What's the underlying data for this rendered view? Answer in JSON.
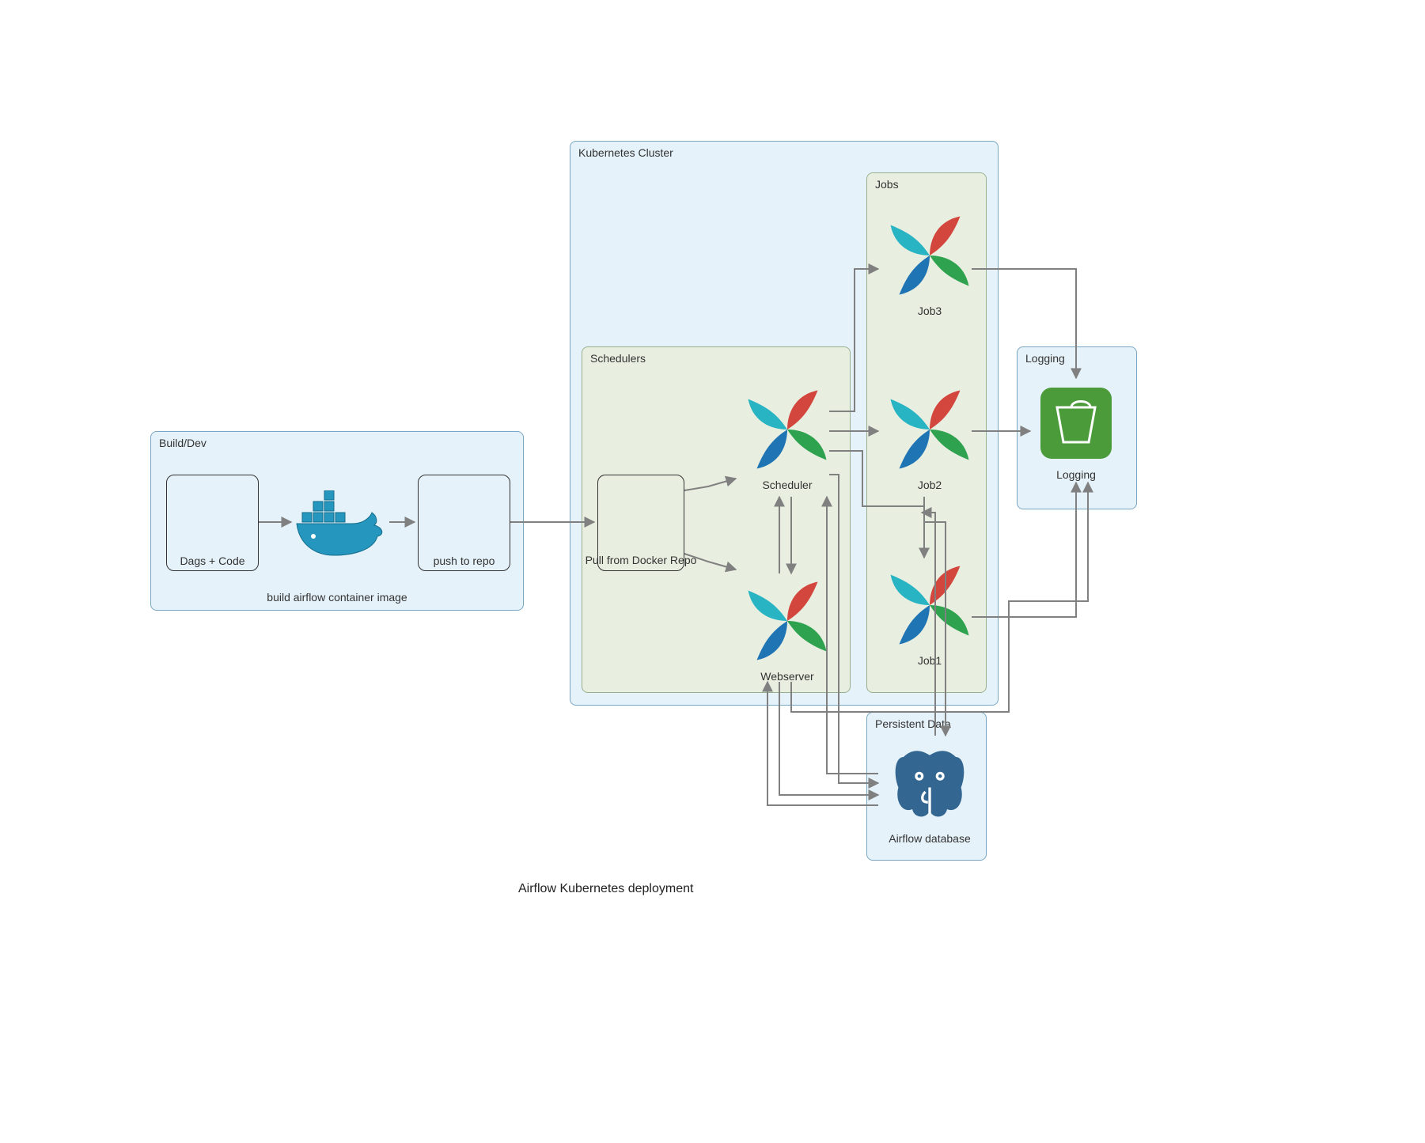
{
  "title": "Airflow Kubernetes deployment",
  "clusters": {
    "build_dev": {
      "label": "Build/Dev",
      "caption": "build airflow container image"
    },
    "kubernetes": {
      "label": "Kubernetes Cluster"
    },
    "schedulers": {
      "label": "Schedulers"
    },
    "jobs": {
      "label": "Jobs"
    },
    "logging": {
      "label": "Logging"
    },
    "persistent": {
      "label": "Persistent Data"
    }
  },
  "nodes": {
    "dags_code": {
      "label": "Dags + Code"
    },
    "push_to_repo": {
      "label": "push to repo"
    },
    "pull_from_repo": {
      "label": "Pull from Docker Repo"
    },
    "scheduler": {
      "label": "Scheduler"
    },
    "webserver": {
      "label": "Webserver"
    },
    "job1": {
      "label": "Job1"
    },
    "job2": {
      "label": "Job2"
    },
    "job3": {
      "label": "Job3"
    },
    "logging_bucket": {
      "label": "Logging"
    },
    "airflow_db": {
      "label": "Airflow database"
    }
  },
  "edges": [
    {
      "from": "dags_code",
      "to": "docker_build"
    },
    {
      "from": "docker_build",
      "to": "push_to_repo"
    },
    {
      "from": "push_to_repo",
      "to": "pull_from_repo"
    },
    {
      "from": "pull_from_repo",
      "to": "scheduler"
    },
    {
      "from": "pull_from_repo",
      "to": "webserver"
    },
    {
      "from": "scheduler",
      "to": "job1"
    },
    {
      "from": "scheduler",
      "to": "job2"
    },
    {
      "from": "scheduler",
      "to": "job3"
    },
    {
      "from": "webserver",
      "to": "scheduler",
      "bidirectional": true
    },
    {
      "from": "webserver",
      "to": "airflow_db",
      "bidirectional": true
    },
    {
      "from": "scheduler",
      "to": "airflow_db",
      "bidirectional": true
    },
    {
      "from": "job2",
      "to": "airflow_db",
      "bidirectional": true
    },
    {
      "from": "job1",
      "to": "logging_bucket"
    },
    {
      "from": "job2",
      "to": "logging_bucket"
    },
    {
      "from": "job3",
      "to": "logging_bucket"
    },
    {
      "from": "webserver",
      "to": "logging_bucket"
    }
  ],
  "colors": {
    "cluster_blue": "#e5f2f9",
    "cluster_green": "#e8efe0",
    "arrow": "#808080"
  }
}
